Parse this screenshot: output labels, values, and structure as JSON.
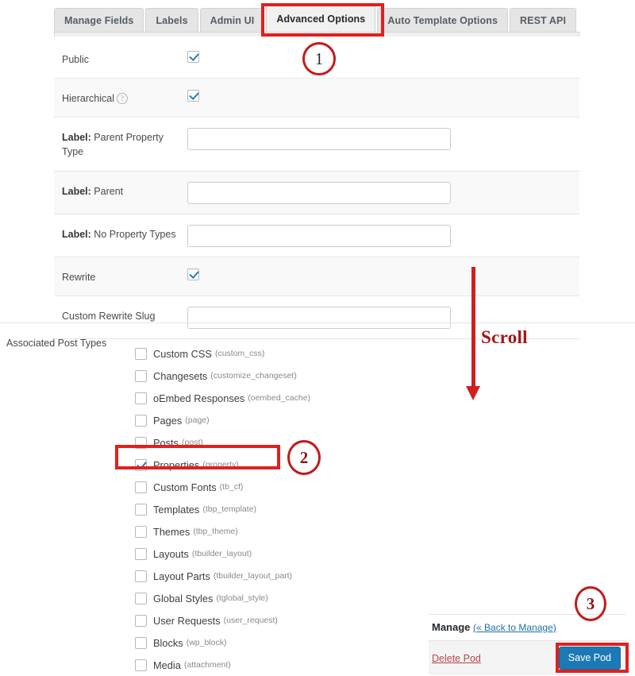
{
  "tabs": [
    {
      "label": "Manage Fields",
      "active": false
    },
    {
      "label": "Labels",
      "active": false
    },
    {
      "label": "Admin UI",
      "active": false
    },
    {
      "label": "Advanced Options",
      "active": true
    },
    {
      "label": "Auto Template Options",
      "active": false
    },
    {
      "label": "REST API",
      "active": false
    }
  ],
  "rows": [
    {
      "label_strong": "",
      "label": "Public",
      "type": "checkbox",
      "checked": true,
      "help": false,
      "alt": false
    },
    {
      "label_strong": "",
      "label": "Hierarchical",
      "type": "checkbox",
      "checked": true,
      "help": true,
      "alt": true
    },
    {
      "label_strong": "Label:",
      "label": " Parent Property Type",
      "type": "text",
      "value": "",
      "alt": false
    },
    {
      "label_strong": "Label:",
      "label": " Parent",
      "type": "text",
      "value": "",
      "alt": true
    },
    {
      "label_strong": "Label:",
      "label": " No Property Types",
      "type": "text",
      "value": "",
      "alt": false
    },
    {
      "label_strong": "",
      "label": "Rewrite",
      "type": "checkbox",
      "checked": true,
      "help": false,
      "alt": true
    },
    {
      "label_strong": "",
      "label": "Custom Rewrite Slug",
      "type": "text",
      "value": "",
      "alt": false
    }
  ],
  "associated_post_types": {
    "label": "Associated Post Types",
    "items": [
      {
        "name": "Custom CSS",
        "slug": "(custom_css)",
        "checked": false
      },
      {
        "name": "Changesets",
        "slug": "(customize_changeset)",
        "checked": false
      },
      {
        "name": "oEmbed Responses",
        "slug": "(oembed_cache)",
        "checked": false
      },
      {
        "name": "Pages",
        "slug": "(page)",
        "checked": false
      },
      {
        "name": "Posts",
        "slug": "(post)",
        "checked": false
      },
      {
        "name": "Properties",
        "slug": "(property)",
        "checked": true
      },
      {
        "name": "Custom Fonts",
        "slug": "(tb_cf)",
        "checked": false
      },
      {
        "name": "Templates",
        "slug": "(tbp_template)",
        "checked": false
      },
      {
        "name": "Themes",
        "slug": "(tbp_theme)",
        "checked": false
      },
      {
        "name": "Layouts",
        "slug": "(tbuilder_layout)",
        "checked": false
      },
      {
        "name": "Layout Parts",
        "slug": "(tbuilder_layout_part)",
        "checked": false
      },
      {
        "name": "Global Styles",
        "slug": "(tglobal_style)",
        "checked": false
      },
      {
        "name": "User Requests",
        "slug": "(user_request)",
        "checked": false
      },
      {
        "name": "Blocks",
        "slug": "(wp_block)",
        "checked": false
      },
      {
        "name": "Media",
        "slug": "(attachment)",
        "checked": false
      }
    ]
  },
  "manage": {
    "title": "Manage",
    "back_link": "(« Back to Manage)",
    "delete_label": "Delete Pod",
    "save_label": "Save Pod"
  },
  "annotations": {
    "marker1": "1",
    "marker2": "2",
    "marker3": "3",
    "scroll_label": "Scroll",
    "accent_red": "#e02020",
    "marker_red": "#c21b1b",
    "arrow_red": "#cf1f1f"
  }
}
